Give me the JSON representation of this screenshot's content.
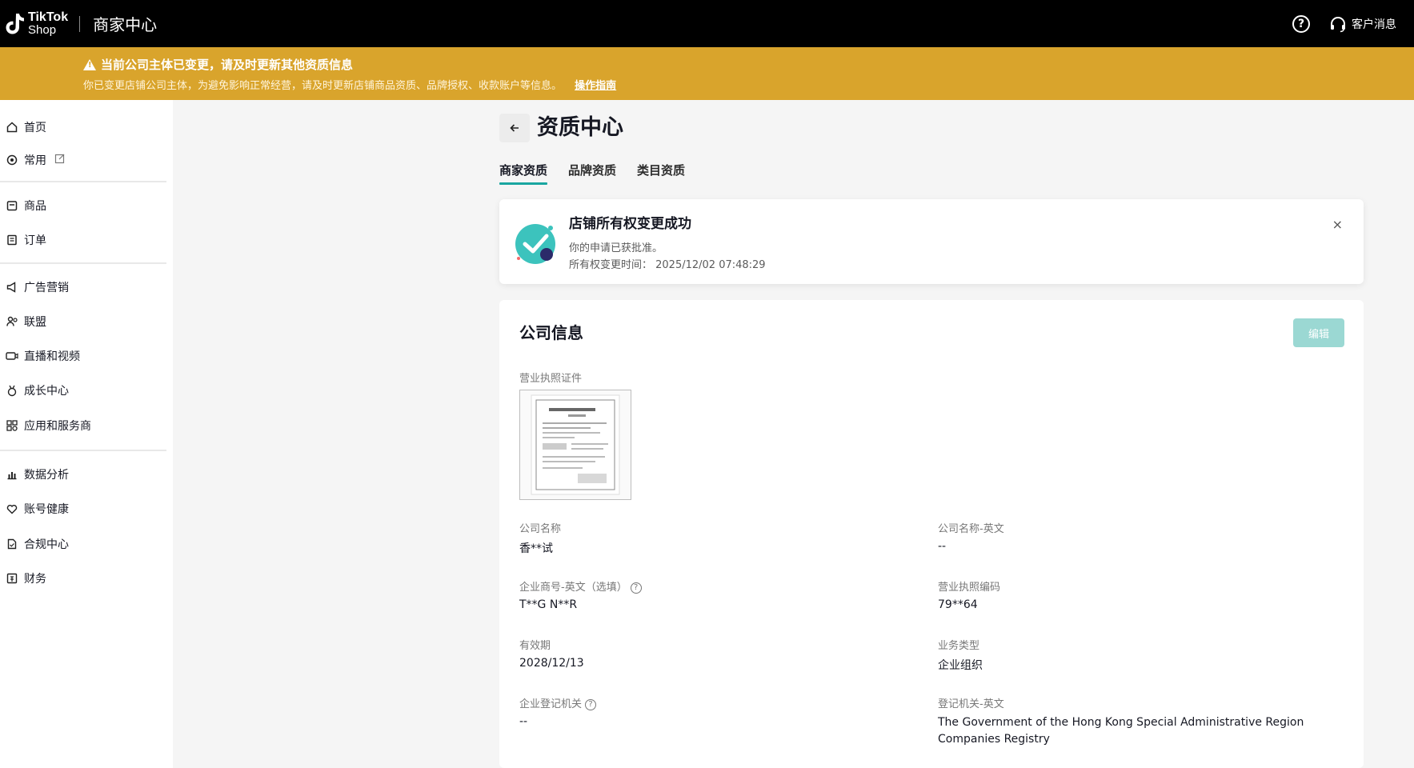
{
  "topbar": {
    "logo_line1": "TikTok",
    "logo_line2": "Shop",
    "app_title": "商家中心",
    "help_label": "?",
    "customer_service": "客户消息"
  },
  "banner": {
    "title": "当前公司主体已变更，请及时更新其他资质信息",
    "description": "你已变更店铺公司主体，为避免影响正常经营，请及时更新店铺商品资质、品牌授权、收款账户等信息。",
    "link": "操作指南",
    "color": "#d9a42c"
  },
  "sidebar": {
    "items": [
      {
        "label": "首页",
        "icon": "home-icon"
      },
      {
        "label": "常用",
        "icon": "star-icon"
      },
      {
        "label": "商品",
        "icon": "product-icon"
      },
      {
        "label": "订单",
        "icon": "order-icon"
      },
      {
        "label": "广告营销",
        "icon": "megaphone-icon"
      },
      {
        "label": "联盟",
        "icon": "people-icon"
      },
      {
        "label": "直播和视频",
        "icon": "video-icon"
      },
      {
        "label": "成长中心",
        "icon": "medal-icon"
      },
      {
        "label": "应用和服务商",
        "icon": "apps-icon"
      },
      {
        "label": "数据分析",
        "icon": "chart-icon"
      },
      {
        "label": "账号健康",
        "icon": "health-icon"
      },
      {
        "label": "合规中心",
        "icon": "compliance-icon"
      },
      {
        "label": "财务",
        "icon": "finance-icon"
      }
    ]
  },
  "main": {
    "title": "资质中心",
    "tabs": [
      {
        "label": "商家资质",
        "active": true
      },
      {
        "label": "品牌资质",
        "active": false
      },
      {
        "label": "类目资质",
        "active": false
      }
    ],
    "notice": {
      "title": "店铺所有权变更成功",
      "line1": "你的申请已获批准。",
      "line2": "所有权变更时间： 2025/12/02 07:48:29",
      "close": "×"
    },
    "company": {
      "title": "公司信息",
      "edit_label": "编辑",
      "license_label": "营业执照证件",
      "fields": [
        {
          "label": "公司名称",
          "value": "香**试"
        },
        {
          "label": "公司名称-英文",
          "value": "--"
        },
        {
          "label": "企业商号-英文（选填）",
          "value": "T**G N**R"
        },
        {
          "label": "营业执照编码",
          "value": "79**64"
        },
        {
          "label": "有效期",
          "value": "2028/12/13"
        },
        {
          "label": "业务类型",
          "value": "企业组织"
        },
        {
          "label": "企业登记机关",
          "value": "--"
        },
        {
          "label": "登记机关-英文",
          "value": "The Government of the Hong Kong Special Administrative Region Companies Registry"
        }
      ]
    }
  },
  "colors": {
    "accent": "#1aa6a0",
    "edit_button_disabled": "#9bd8d3"
  }
}
